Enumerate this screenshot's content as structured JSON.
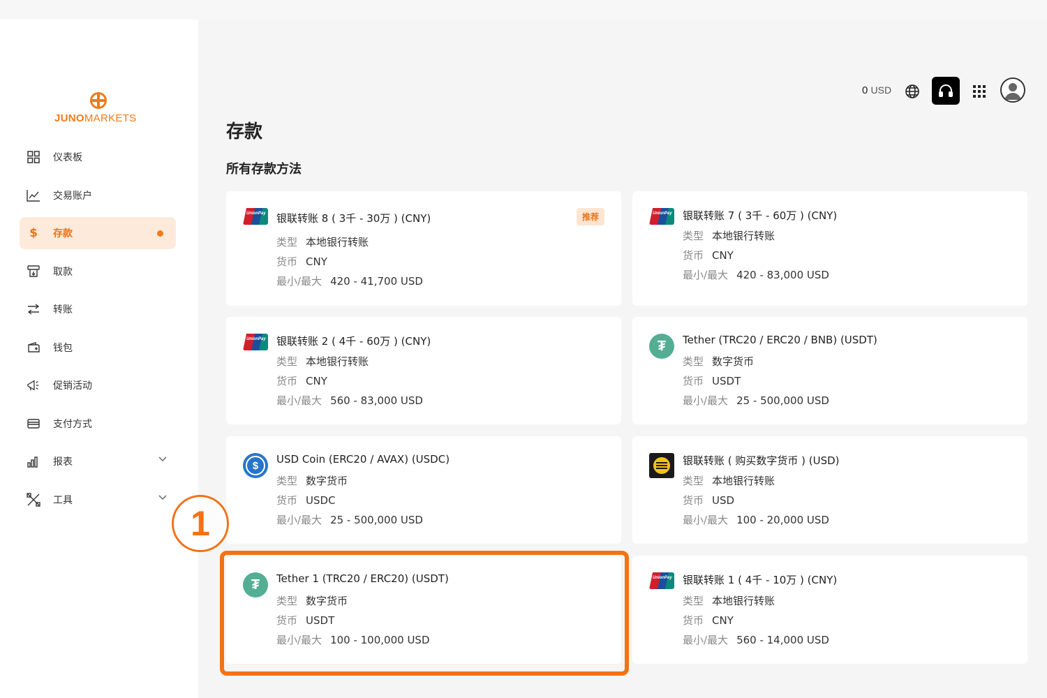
{
  "brand": {
    "part1": "JUNO",
    "part2": "MARKETS",
    "accent": "#f07a1a"
  },
  "sidebar": {
    "items": [
      {
        "label": "仪表板",
        "icon": "dashboard-icon"
      },
      {
        "label": "交易账户",
        "icon": "chart-line-icon"
      },
      {
        "label": "存款",
        "icon": "dollar-icon",
        "active": true
      },
      {
        "label": "取款",
        "icon": "withdraw-icon"
      },
      {
        "label": "转账",
        "icon": "transfer-icon"
      },
      {
        "label": "钱包",
        "icon": "wallet-icon"
      },
      {
        "label": "促销活动",
        "icon": "megaphone-icon"
      },
      {
        "label": "支付方式",
        "icon": "card-icon"
      },
      {
        "label": "报表",
        "icon": "bar-chart-icon",
        "expandable": true
      },
      {
        "label": "工具",
        "icon": "tools-icon",
        "expandable": true
      }
    ],
    "active_glyph": "$"
  },
  "header": {
    "balance_value": "0",
    "balance_unit": "USD"
  },
  "page": {
    "title": "存款",
    "section": "所有存款方法"
  },
  "labels": {
    "type": "类型",
    "currency": "货币",
    "minmax": "最小/最大"
  },
  "cards": [
    {
      "title": "银联转账 8 ( 3千 - 30万 ) (CNY)",
      "type": "本地银行转账",
      "currency": "CNY",
      "range": "420 - 41,700 USD",
      "icon": "unionpay-icon",
      "badge": "推荐"
    },
    {
      "title": "银联转账 7 ( 3千 - 60万 ) (CNY)",
      "type": "本地银行转账",
      "currency": "CNY",
      "range": "420 - 83,000 USD",
      "icon": "unionpay-icon"
    },
    {
      "title": "银联转账 2 ( 4千 - 60万 ) (CNY)",
      "type": "本地银行转账",
      "currency": "CNY",
      "range": "560 - 83,000 USD",
      "icon": "unionpay-icon"
    },
    {
      "title": "Tether (TRC20 / ERC20 / BNB) (USDT)",
      "type": "数字货币",
      "currency": "USDT",
      "range": "25 - 500,000 USD",
      "icon": "tether-icon"
    },
    {
      "title": "USD Coin (ERC20 / AVAX) (USDC)",
      "type": "数字货币",
      "currency": "USDC",
      "range": "25 - 500,000 USD",
      "icon": "usdc-icon"
    },
    {
      "title": "银联转账 ( 购买数字货币 ) (USD)",
      "type": "本地银行转账",
      "currency": "USD",
      "range": "100 - 20,000 USD",
      "icon": "bank-coin-icon"
    },
    {
      "title": "Tether 1 (TRC20 / ERC20) (USDT)",
      "type": "数字货币",
      "currency": "USDT",
      "range": "100 - 100,000 USD",
      "icon": "tether-icon",
      "highlighted": true
    },
    {
      "title": "银联转账 1 ( 4千 - 10万 ) (CNY)",
      "type": "本地银行转账",
      "currency": "CNY",
      "range": "560 - 14,000 USD",
      "icon": "unionpay-icon"
    }
  ],
  "annotation": {
    "step": "1",
    "color": "#f37216"
  }
}
